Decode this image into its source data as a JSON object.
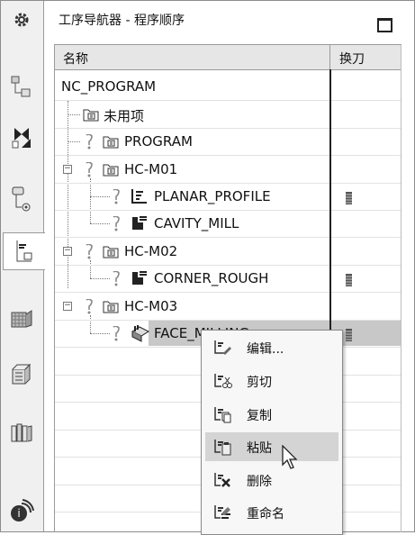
{
  "window": {
    "title": "工序导航器 - 程序顺序",
    "maximize_icon": "maximize-icon"
  },
  "sidebar": {
    "items": [
      {
        "name": "settings",
        "icon": "gear-icon"
      },
      {
        "name": "assembly-navigator",
        "icon": "assembly-icon"
      },
      {
        "name": "constraint-navigator",
        "icon": "constraint-icon"
      },
      {
        "name": "part-navigator",
        "icon": "part-icon"
      },
      {
        "name": "operation-navigator",
        "icon": "operation-icon",
        "active": true
      },
      {
        "name": "machine-tool-navigator",
        "icon": "machine-icon"
      },
      {
        "name": "reuse-library",
        "icon": "library-icon"
      },
      {
        "name": "history",
        "icon": "books-icon"
      },
      {
        "name": "roles",
        "icon": "roles-icon"
      }
    ]
  },
  "table": {
    "columns": {
      "name": "名称",
      "tool_change": "换刀"
    },
    "rows": [
      {
        "label": "NC_PROGRAM",
        "level": 0,
        "type": "root"
      },
      {
        "label": "未用项",
        "level": 1,
        "type": "group"
      },
      {
        "label": "PROGRAM",
        "level": 1,
        "type": "program"
      },
      {
        "label": "HC-M01",
        "level": 1,
        "type": "program",
        "expanded": true
      },
      {
        "label": "PLANAR_PROFILE",
        "level": 2,
        "type": "operation",
        "tool_change": true
      },
      {
        "label": "CAVITY_MILL",
        "level": 2,
        "type": "operation",
        "tool_change": false
      },
      {
        "label": "HC-M02",
        "level": 1,
        "type": "program",
        "expanded": true
      },
      {
        "label": "CORNER_ROUGH",
        "level": 2,
        "type": "operation",
        "tool_change": true
      },
      {
        "label": "HC-M03",
        "level": 1,
        "type": "program",
        "expanded": true
      },
      {
        "label": "FACE_MILLING",
        "level": 2,
        "type": "operation",
        "tool_change": true,
        "selected": true
      }
    ]
  },
  "context_menu": {
    "items": [
      {
        "label": "编辑...",
        "icon": "edit-icon"
      },
      {
        "label": "剪切",
        "icon": "cut-icon"
      },
      {
        "label": "复制",
        "icon": "copy-icon"
      },
      {
        "label": "粘贴",
        "icon": "paste-icon",
        "hover": true
      },
      {
        "label": "删除",
        "icon": "delete-icon"
      },
      {
        "label": "重命名",
        "icon": "rename-icon"
      }
    ]
  }
}
